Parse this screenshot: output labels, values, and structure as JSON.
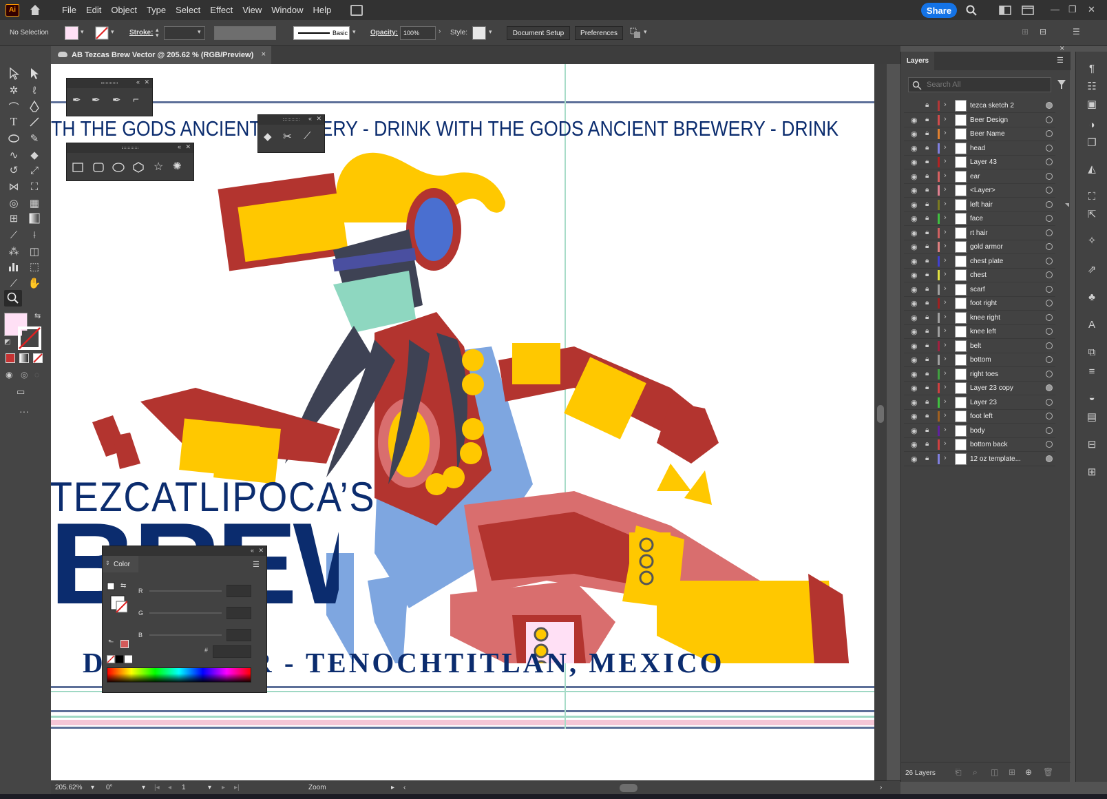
{
  "menubar": {
    "app_logo": "Ai",
    "items": [
      "File",
      "Edit",
      "Object",
      "Type",
      "Select",
      "Effect",
      "View",
      "Window",
      "Help"
    ],
    "share_label": "Share"
  },
  "controlbar": {
    "selection_status": "No Selection",
    "stroke_label": "Stroke:",
    "brush_style": "Basic",
    "opacity_label": "Opacity:",
    "opacity_value": "100%",
    "style_label": "Style:",
    "document_setup_label": "Document Setup",
    "preferences_label": "Preferences"
  },
  "tab": {
    "title": "AB Tezcas Brew Vector @ 205.62 % (RGB/Preview)",
    "close": "×"
  },
  "artwork": {
    "banner_line": "TH THE GODS   ANCIENT BREWERY - DRINK WITH THE GODS   ANCIENT BREWERY - DRINK",
    "title_small": "TEZCATLIPOCA’S",
    "title_big": "BREW",
    "subtitle": "DARK BEER - TENOCHTITLAN, MEXICO"
  },
  "layers": {
    "tab_label": "Layers",
    "search_placeholder": "Search All",
    "count_label": "26 Layers",
    "rows": [
      {
        "name": "tezca sketch 2",
        "color": "#b33636",
        "visible": false,
        "target_filled": true
      },
      {
        "name": "Beer Design",
        "color": "#d14b4b",
        "visible": true,
        "target_filled": false
      },
      {
        "name": "Beer Name",
        "color": "#e08030",
        "visible": true,
        "target_filled": false
      },
      {
        "name": "head",
        "color": "#8080e0",
        "visible": true,
        "target_filled": false
      },
      {
        "name": "Layer 43",
        "color": "#b22222",
        "visible": true,
        "target_filled": false
      },
      {
        "name": "ear",
        "color": "#d86060",
        "visible": true,
        "target_filled": false
      },
      {
        "name": "<Layer>",
        "color": "#e08090",
        "visible": true,
        "target_filled": false
      },
      {
        "name": "left hair",
        "color": "#7a7a20",
        "visible": true,
        "target_filled": false
      },
      {
        "name": "face",
        "color": "#40c040",
        "visible": true,
        "target_filled": false
      },
      {
        "name": "rt hair",
        "color": "#d06060",
        "visible": true,
        "target_filled": false
      },
      {
        "name": "gold armor",
        "color": "#e08080",
        "visible": true,
        "target_filled": false
      },
      {
        "name": "chest plate",
        "color": "#4040d0",
        "visible": true,
        "target_filled": false
      },
      {
        "name": "chest",
        "color": "#e0e040",
        "visible": true,
        "target_filled": false
      },
      {
        "name": "scarf",
        "color": "#a0a0a0",
        "visible": true,
        "target_filled": false
      },
      {
        "name": "foot right",
        "color": "#a02020",
        "visible": true,
        "target_filled": false
      },
      {
        "name": "knee right",
        "color": "#a0a0a0",
        "visible": true,
        "target_filled": false
      },
      {
        "name": "knee left",
        "color": "#a0a0a0",
        "visible": true,
        "target_filled": false
      },
      {
        "name": "belt",
        "color": "#a02040",
        "visible": true,
        "target_filled": false
      },
      {
        "name": "bottom",
        "color": "#a0a0a0",
        "visible": true,
        "target_filled": false
      },
      {
        "name": "right toes",
        "color": "#40a040",
        "visible": true,
        "target_filled": false
      },
      {
        "name": "Layer 23 copy",
        "color": "#d04040",
        "visible": true,
        "target_filled": true
      },
      {
        "name": "Layer 23",
        "color": "#40c040",
        "visible": true,
        "target_filled": false
      },
      {
        "name": "foot left",
        "color": "#a06020",
        "visible": true,
        "target_filled": false
      },
      {
        "name": "body",
        "color": "#6020a0",
        "visible": true,
        "target_filled": false
      },
      {
        "name": "bottom back",
        "color": "#d04040",
        "visible": true,
        "target_filled": false
      },
      {
        "name": "12 oz template...",
        "color": "#8080e0",
        "visible": true,
        "target_filled": true
      }
    ]
  },
  "color_panel": {
    "title": "Color",
    "r_label": "R",
    "g_label": "G",
    "b_label": "B",
    "hex_label": "#"
  },
  "statusbar": {
    "zoom": "205.62%",
    "rotation": "0°",
    "artboard_index": "1",
    "tool_label": "Zoom"
  },
  "colors": {
    "accent_blue": "#1473e6",
    "navy_text": "#0b2c6e",
    "gold": "#ffc800",
    "red_brick": "#b3342f",
    "fill_swatch": "#ffe0f5"
  }
}
